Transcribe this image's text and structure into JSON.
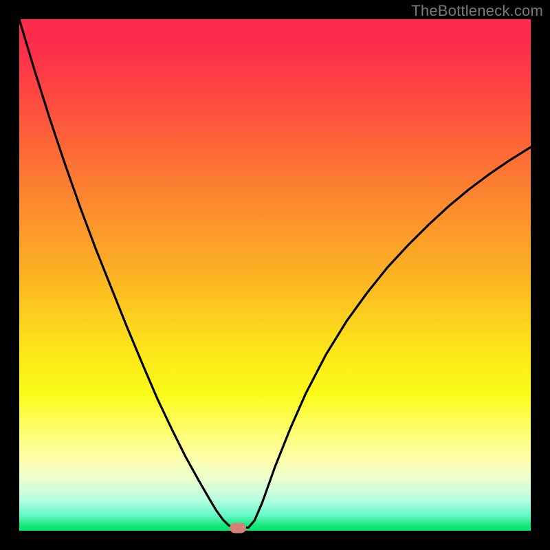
{
  "watermark": "TheBottleneck.com",
  "marker": {
    "x_frac": 0.4275,
    "y_frac": 0.994
  },
  "chart_data": {
    "type": "line",
    "title": "",
    "xlabel": "",
    "ylabel": "",
    "xlim": [
      0,
      1
    ],
    "ylim": [
      0,
      1
    ],
    "series": [
      {
        "name": "bottleneck-curve",
        "x": [
          0.0,
          0.03,
          0.06,
          0.09,
          0.12,
          0.15,
          0.18,
          0.21,
          0.24,
          0.27,
          0.3,
          0.325,
          0.35,
          0.37,
          0.385,
          0.398,
          0.408,
          0.416,
          0.448,
          0.46,
          0.475,
          0.5,
          0.53,
          0.56,
          0.6,
          0.64,
          0.68,
          0.72,
          0.76,
          0.8,
          0.84,
          0.88,
          0.92,
          0.96,
          1.0
        ],
        "y": [
          1.0,
          0.9,
          0.805,
          0.715,
          0.63,
          0.55,
          0.475,
          0.4,
          0.328,
          0.258,
          0.195,
          0.145,
          0.1,
          0.065,
          0.04,
          0.022,
          0.012,
          0.006,
          0.006,
          0.02,
          0.055,
          0.125,
          0.2,
          0.268,
          0.345,
          0.41,
          0.465,
          0.515,
          0.558,
          0.598,
          0.635,
          0.668,
          0.698,
          0.725,
          0.75
        ]
      }
    ],
    "flat_bottom": {
      "x_start": 0.416,
      "x_end": 0.448,
      "y": 0.006
    },
    "marker_point": {
      "x": 0.4275,
      "y": 0.006
    },
    "background_gradient": "vertical rainbow (red top to green bottom)"
  }
}
